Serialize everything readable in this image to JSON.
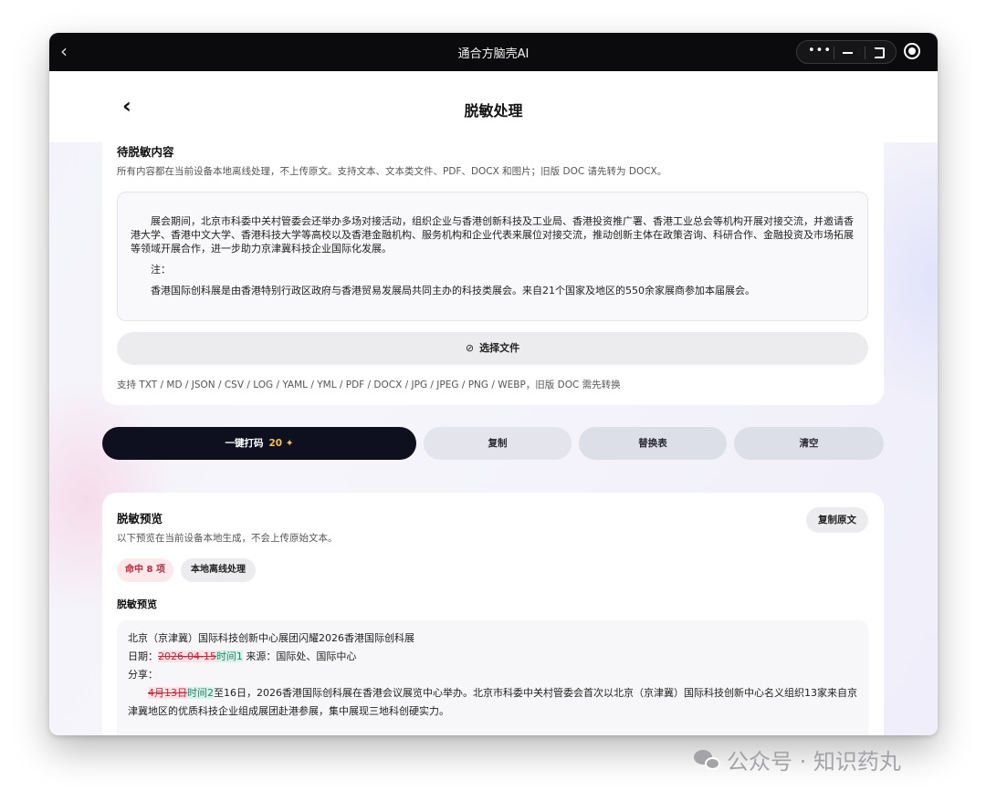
{
  "window": {
    "title": "通合方脑壳AI",
    "back_glyph": "‹",
    "menu_glyph": "•••"
  },
  "nav": {
    "back_glyph": "‹",
    "title": "脱敏处理"
  },
  "input_section": {
    "title": "待脱敏内容",
    "description": "所有内容都在当前设备本地离线处理，不上传原文。支持文本、文本类文件、PDF、DOCX 和图片；旧版 DOC 请先转为 DOCX。",
    "editor": {
      "paragraph1": "展会期间，北京市科委中关村管委会还举办多场对接活动，组织企业与香港创新科技及工业局、香港投资推广署、香港工业总会等机构开展对接交流，并邀请香港大学、香港中文大学、香港科技大学等高校以及香港金融机构、服务机构和企业代表来展位对接交流，推动创新主体在政策咨询、科研合作、金融投资及市场拓展等领域开展合作，进一步助力京津冀科技企业国际化发展。",
      "note_label": "注：",
      "paragraph2": "香港国际创科展是由香港特别行政区政府与香港贸易发展局共同主办的科技类展会。来自21个国家及地区的550余家展商参加本届展会。"
    },
    "file_button": "选择文件",
    "support_text": "支持 TXT / MD / JSON / CSV / LOG / YAML / YML / PDF / DOCX / JPG / JPEG / PNG / WEBP，旧版 DOC 需先转换"
  },
  "actions": {
    "mask_label": "一键打码",
    "mask_count": "20 ✦",
    "copy_label": "复制",
    "replace_label": "替换表",
    "clear_label": "清空"
  },
  "preview_section": {
    "title": "脱敏预览",
    "description": "以下预览在当前设备本地生成，不会上传原始文本。",
    "copy_original": "复制原文",
    "hit_badge": "命中 8 项",
    "local_badge": "本地离线处理",
    "sub_title": "脱敏预览",
    "line1": "北京（京津冀）国际科技创新中心展团闪耀2026香港国际创科展",
    "line2_prefix": "日期：",
    "line2_deleted": "2026-04-15",
    "line2_inserted": "时间1",
    "line2_suffix": " 来源：国际处、国际中心",
    "line3": "分享：",
    "line4_deleted": "4月13日",
    "line4_inserted": "时间2",
    "line4_suffix": "至16日，2026香港国际创科展在香港会议展览中心举办。北京市科委中关村管委会首次以北京（京津冀）国际科技创新中心名义组织13家来自京津冀地区的优质科技企业组成展团赴港参展，集中展现三地科创硬实力。"
  },
  "watermark": {
    "text": "公众号 · 知识药丸"
  }
}
